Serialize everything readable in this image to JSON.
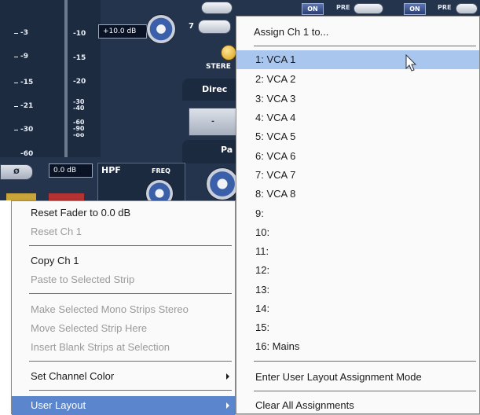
{
  "mixer": {
    "meter_scale_left": [
      "-3",
      "-9",
      "-15",
      "-21",
      "-30",
      "-60"
    ],
    "meter_scale_right": [
      "-10",
      "-15",
      "-20",
      "-30",
      "-40",
      "-60",
      "-90",
      "-oo"
    ],
    "gain_display": "+10.0 dB",
    "fader_display": "0.0 dB",
    "hpf_label": "HPF",
    "freq_label": "FREQ",
    "polarity_symbol": "Ø",
    "insert_number": "7",
    "stereo_label": "STERE",
    "direct_label": "Direc",
    "pan_label": "Pa",
    "on_label": "ON",
    "pre_label": "PRE",
    "direct_button_label": "-"
  },
  "context_menu": {
    "groups": [
      [
        {
          "label": "Reset Fader to 0.0 dB",
          "enabled": true
        },
        {
          "label": "Reset Ch 1",
          "enabled": false
        }
      ],
      [
        {
          "label": "Copy Ch 1",
          "enabled": true
        },
        {
          "label": "Paste to Selected Strip",
          "enabled": false
        }
      ],
      [
        {
          "label": "Make Selected Mono Strips Stereo",
          "enabled": false
        },
        {
          "label": "Move Selected Strip Here",
          "enabled": false
        },
        {
          "label": "Insert Blank Strips at Selection",
          "enabled": false
        }
      ],
      [
        {
          "label": "Set Channel Color",
          "enabled": true,
          "submenu": true
        }
      ],
      [
        {
          "label": "User Layout",
          "enabled": true,
          "submenu": true,
          "highlighted": true
        }
      ]
    ]
  },
  "submenu": {
    "title": "Assign Ch 1 to...",
    "items": [
      {
        "label": "1: VCA 1",
        "highlighted": true
      },
      {
        "label": "2: VCA 2"
      },
      {
        "label": "3: VCA 3"
      },
      {
        "label": "4: VCA 4"
      },
      {
        "label": "5: VCA 5"
      },
      {
        "label": "6: VCA 6"
      },
      {
        "label": "7: VCA 7"
      },
      {
        "label": "8: VCA 8"
      },
      {
        "label": "9:"
      },
      {
        "label": "10:"
      },
      {
        "label": "11:"
      },
      {
        "label": "12:"
      },
      {
        "label": "13:"
      },
      {
        "label": "14:"
      },
      {
        "label": "15:"
      },
      {
        "label": "16: Mains"
      }
    ],
    "enter_mode": "Enter User Layout Assignment Mode",
    "clear_all": "Clear All Assignments"
  },
  "colors": {
    "panel_bg": "#25344d",
    "highlight_submenu": "#a9c6ef",
    "highlight_menu": "#5b85cc"
  }
}
